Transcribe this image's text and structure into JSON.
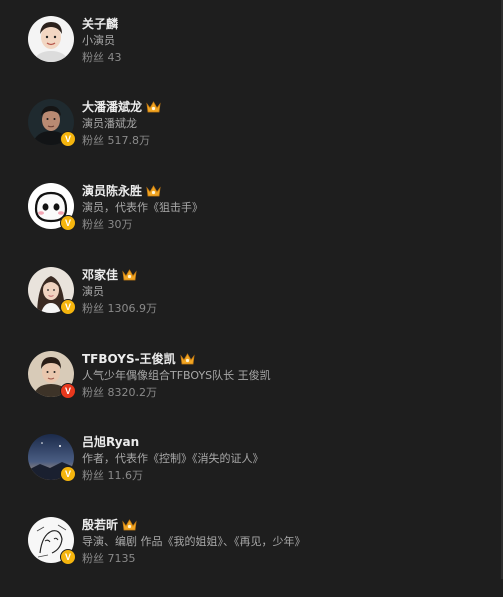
{
  "users": [
    {
      "name": "关子麟",
      "desc": "小演员",
      "fans": "粉丝 43",
      "verified": false,
      "verified_color": "",
      "crown": false,
      "avatar_icon": "child-portrait-icon"
    },
    {
      "name": "大潘潘斌龙",
      "desc": "演员潘斌龙",
      "fans": "粉丝 517.8万",
      "verified": true,
      "verified_color": "#f5b50e",
      "crown": true,
      "avatar_icon": "man-portrait-icon"
    },
    {
      "name": "演员陈永胜",
      "desc": "演员，代表作《狙击手》",
      "fans": "粉丝 30万",
      "verified": true,
      "verified_color": "#f5b50e",
      "crown": true,
      "avatar_icon": "cartoon-face-icon"
    },
    {
      "name": "邓家佳",
      "desc": "演员",
      "fans": "粉丝 1306.9万",
      "verified": true,
      "verified_color": "#f5b50e",
      "crown": true,
      "avatar_icon": "woman-portrait-icon"
    },
    {
      "name": "TFBOYS-王俊凯",
      "desc": "人气少年偶像组合TFBOYS队长 王俊凯",
      "fans": "粉丝 8320.2万",
      "verified": true,
      "verified_color": "#e8381d",
      "crown": true,
      "avatar_icon": "young-man-portrait-icon"
    },
    {
      "name": "吕旭Ryan",
      "desc": "作者，代表作《控制》《消失的证人》",
      "fans": "粉丝 11.6万",
      "verified": true,
      "verified_color": "#f5b50e",
      "crown": false,
      "avatar_icon": "night-sky-icon"
    },
    {
      "name": "殷若昕",
      "desc": "导演、编剧 作品《我的姐姐》、《再见，少年》",
      "fans": "粉丝 7135",
      "verified": true,
      "verified_color": "#f5b50e",
      "crown": true,
      "avatar_icon": "sketch-drawing-icon"
    }
  ],
  "badges": {
    "verified_mark": "V"
  },
  "colors": {
    "background": "#1e1e1e",
    "name_text": "#ececec",
    "desc_text": "#a8a8a8",
    "fans_text": "#8a8a8a",
    "verified_gold": "#f5b50e",
    "verified_red": "#e8381d",
    "crown_gold": "#f2a623"
  }
}
